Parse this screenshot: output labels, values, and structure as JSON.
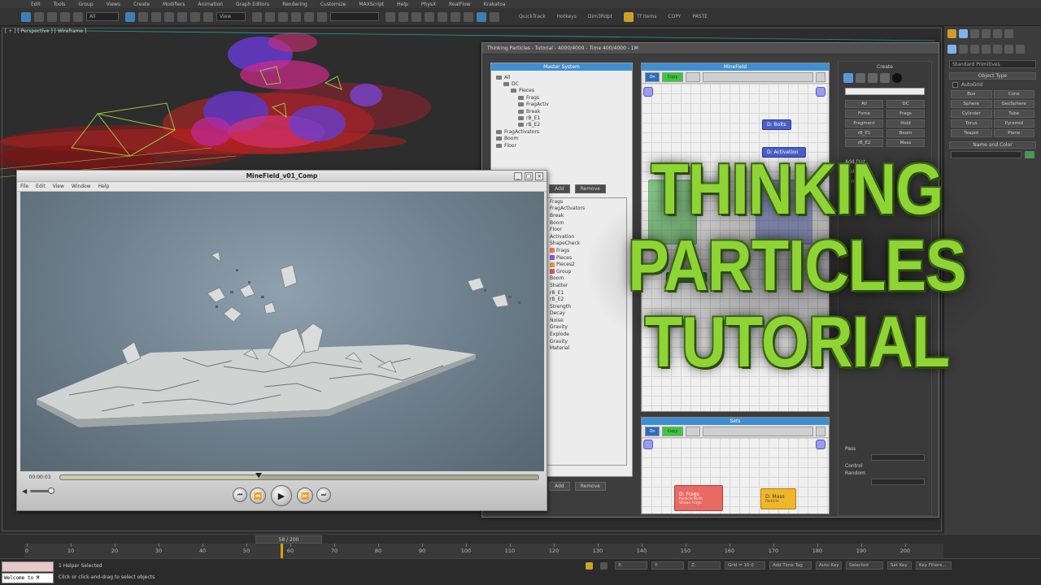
{
  "app": {
    "logo": "S",
    "menus": [
      "Edit",
      "Tools",
      "Group",
      "Views",
      "Create",
      "Modifiers",
      "Animation",
      "Graph Editors",
      "Rendering",
      "Customize",
      "MAXScript",
      "Help",
      "PhysX",
      "RealFlow",
      "Krakatoa"
    ],
    "toolbar": {
      "selection_filter": "All",
      "view_dropdown": "View",
      "texts": [
        "QuickTrack",
        "Hotkeys",
        "Dim3Rdpt",
        "Tf Items",
        "COPY",
        "PASTE"
      ]
    }
  },
  "viewport": {
    "label": "[ + ] [ Perspective ] [ Wireframe ]"
  },
  "command_panel": {
    "dropdown": "Standard Primitives",
    "object_type_title": "Object Type",
    "autogrid_label": "AutoGrid",
    "buttons": [
      "Box",
      "Cone",
      "Sphere",
      "GeoSphere",
      "Cylinder",
      "Tube",
      "Torus",
      "Pyramid",
      "Teapot",
      "Plane"
    ],
    "name_color_title": "Name and Color"
  },
  "tp_window": {
    "title": "Thinking Particles - Tutorial - 4000/4000 - Time 400/4000 - 1M",
    "master_system_head": "Master System",
    "tree": [
      {
        "label": "All",
        "indent": 1
      },
      {
        "label": "DC",
        "indent": 2
      },
      {
        "label": "Pieces",
        "indent": 3
      },
      {
        "label": "Frags",
        "indent": 4
      },
      {
        "label": "FragActiv",
        "indent": 4
      },
      {
        "label": "Break",
        "indent": 4
      },
      {
        "label": "rB_E1",
        "indent": 4
      },
      {
        "label": "rB_E2",
        "indent": 4
      },
      {
        "label": "FragActivators",
        "indent": 1
      },
      {
        "label": "Boom",
        "indent": 1
      },
      {
        "label": "Floor",
        "indent": 1
      }
    ],
    "tree_buttons": [
      "Add",
      "Remove"
    ],
    "list_items": [
      {
        "label": "Frags",
        "color": ""
      },
      {
        "label": "FragActivators",
        "color": ""
      },
      {
        "label": "Break",
        "color": ""
      },
      {
        "label": "Boom",
        "color": ""
      },
      {
        "label": "Floor",
        "color": ""
      },
      {
        "label": "Activation",
        "color": ""
      },
      {
        "label": "ShapeCheck",
        "color": ""
      },
      {
        "label": "Frags",
        "color": "#e87a5a"
      },
      {
        "label": "Pieces",
        "color": "#8a5ad8"
      },
      {
        "label": "Pieces2",
        "color": "#d8a23a"
      },
      {
        "label": "Group",
        "color": "#d85a5a"
      },
      {
        "label": "Boom",
        "color": ""
      },
      {
        "label": "Shatter",
        "color": ""
      },
      {
        "label": "rB_E1",
        "color": ""
      },
      {
        "label": "rB_E2",
        "color": ""
      },
      {
        "label": "Strength",
        "color": ""
      },
      {
        "label": "Decay",
        "color": ""
      },
      {
        "label": "Noise",
        "color": ""
      },
      {
        "label": "Gravity",
        "color": ""
      },
      {
        "label": "Explode",
        "color": ""
      },
      {
        "label": "Gravity",
        "color": ""
      },
      {
        "label": "Material",
        "color": ""
      }
    ],
    "list_buttons": [
      "Add",
      "Remove"
    ],
    "flow_top": {
      "head": "MineField",
      "tab_blue": "On",
      "tab_green": "Copy",
      "nodes": {
        "n1": "D: Bolts",
        "n2": "D: Activation"
      }
    },
    "flow_bottom": {
      "head": "Sets",
      "tab_blue": "On",
      "tab_green": "Copy",
      "red_node": "D: Frags",
      "red_node_sub": "Particle Birth",
      "red_node_sub2": "Shape Frags",
      "yellow_node": "D: Mass",
      "yellow_node_sub": "Particle"
    },
    "right": {
      "title": "Create",
      "labels": [
        "All",
        "Force",
        "Fragment",
        "rB_E1",
        "rB_E2"
      ],
      "labels2": [
        "DC",
        "Frags",
        "Hold",
        "Boom",
        "Mass"
      ],
      "spinner_labels": [
        "Add Dist",
        "Add Dist",
        "Remove"
      ],
      "bottom_labels": [
        "Pass",
        "Control",
        "Random"
      ]
    }
  },
  "player": {
    "title": "MineField_v01_Comp",
    "menus": [
      "File",
      "Edit",
      "View",
      "Window",
      "Help"
    ],
    "time": "00:00:03",
    "progress": 0.415,
    "volume": 0.85,
    "buttons": {
      "start": "⏮",
      "rewind": "⏪",
      "play": "▶",
      "forward": "⏩",
      "end": "⏭"
    }
  },
  "headline": {
    "line1": "THINKING",
    "line2": "PARTICLES",
    "line3": "TUTORIAL",
    "color": "#8fd435"
  },
  "timeline": {
    "slider_label": "58 / 200",
    "current_frame": 58,
    "max_frame": 200,
    "ticks": [
      0,
      10,
      20,
      30,
      40,
      50,
      60,
      70,
      80,
      90,
      100,
      110,
      120,
      130,
      140,
      150,
      160,
      170,
      180,
      190,
      200
    ]
  },
  "status": {
    "listener": "Welcome to M",
    "line1": "1 Helper Selected",
    "line2": "Click or click-and-drag to select objects",
    "controls": [
      "X:",
      "Y:",
      "Z:",
      "Grid = 10.0",
      "Add Time Tag",
      "Auto Key",
      "Selected",
      "Set Key",
      "Key Filters..."
    ]
  }
}
